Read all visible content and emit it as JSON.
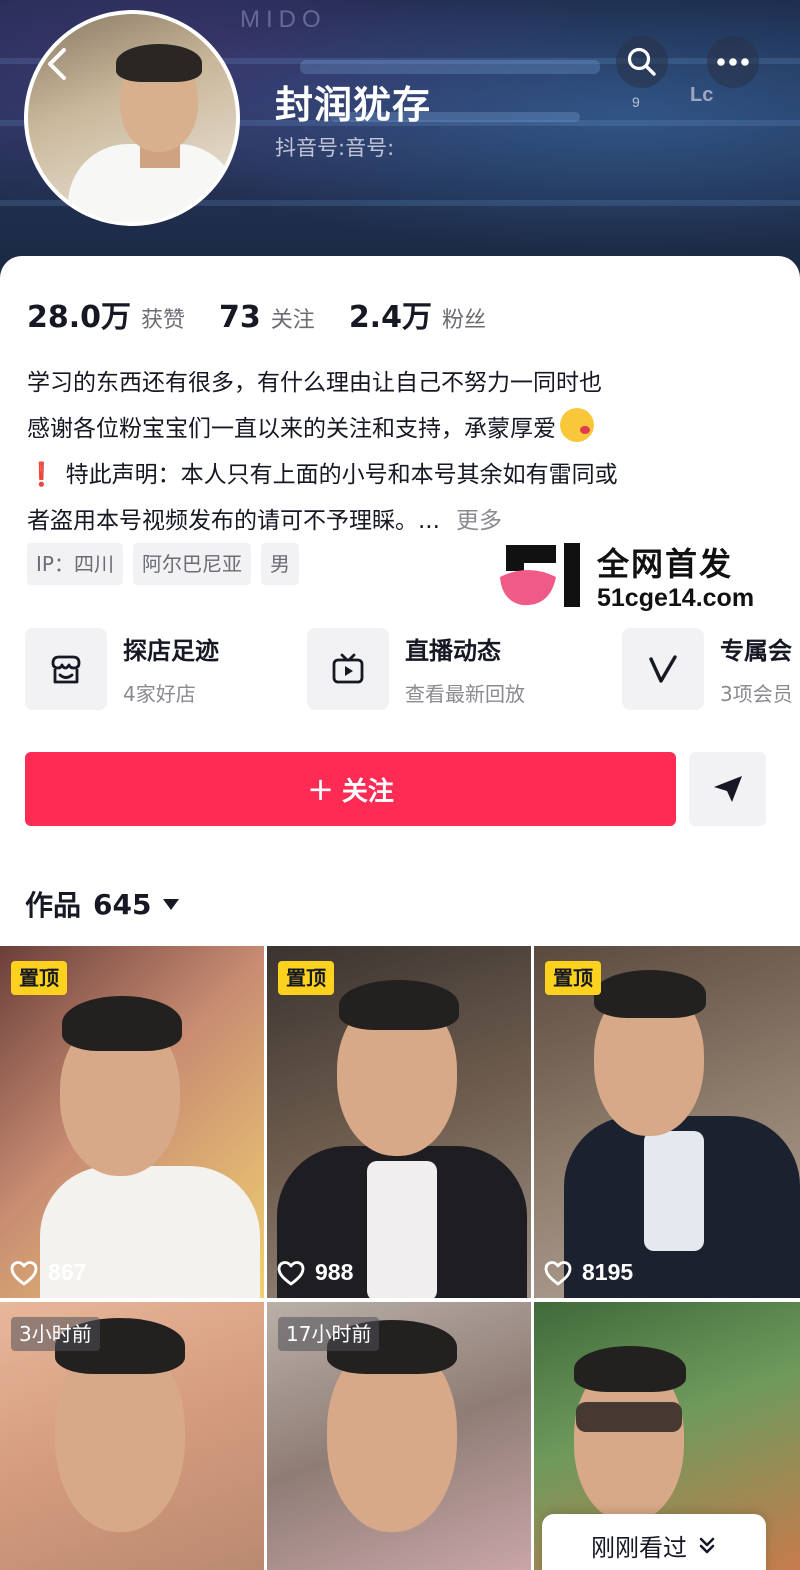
{
  "header": {
    "nickname": "封润犹存",
    "douyin_id": "抖音号:音号:",
    "background_text": "MIDO",
    "sign_small": "9",
    "sign_right": "Lc"
  },
  "stats": {
    "likes_value": "28.0万",
    "likes_label": "获赞",
    "following_value": "73",
    "following_label": "关注",
    "followers_value": "2.4万",
    "followers_label": "粉丝"
  },
  "bio": {
    "line1": "学习的东西还有很多，有什么理由让自己不努力一同时也",
    "line2": "感谢各位粉宝宝们一直以来的关注和支持，承蒙厚爱",
    "line3_mark": "❗",
    "line3": "特此声明：本人只有上面的小号和本号其余如有雷同或",
    "line4": "者盗用本号视频发布的请可不予理睬。...",
    "more": "更多"
  },
  "tags": [
    "IP：四川",
    "阿尔巴尼亚",
    "男"
  ],
  "watermark": {
    "title": "全网首发",
    "url": "51cge14.com"
  },
  "services": [
    {
      "title": "探店足迹",
      "subtitle": "4家好店",
      "icon": "storefront-icon"
    },
    {
      "title": "直播动态",
      "subtitle": "查看最新回放",
      "icon": "tv-live-icon"
    },
    {
      "title": "专属会",
      "subtitle": "3项会员",
      "icon": "v-member-icon"
    }
  ],
  "actions": {
    "follow_label": "关注",
    "follow_plus": "+"
  },
  "works": {
    "label": "作品",
    "count": "645"
  },
  "videos": [
    {
      "badge": "置顶",
      "likes": "867"
    },
    {
      "badge": "置顶",
      "likes": "988"
    },
    {
      "badge": "置顶",
      "likes": "8195"
    },
    {
      "badge": "3小时前",
      "likes": ""
    },
    {
      "badge": "17小时前",
      "likes": ""
    },
    {
      "badge": "",
      "likes": ""
    }
  ],
  "recent": {
    "label": "刚刚看过"
  },
  "colors": {
    "accent": "#fe2c55",
    "pin_badge": "#fcd21e",
    "banner": "#1c2b4a"
  }
}
